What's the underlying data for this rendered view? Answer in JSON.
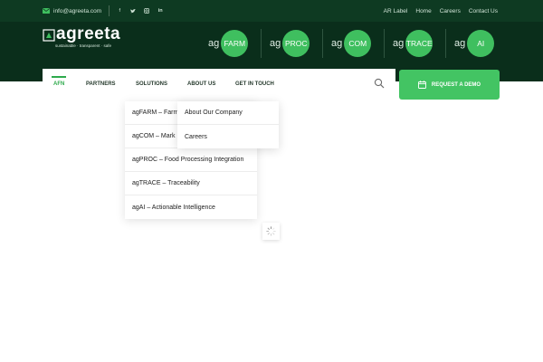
{
  "topbar": {
    "email": "info@agreeta.com",
    "social_icons": [
      "facebook-icon",
      "twitter-icon",
      "instagram-icon",
      "linkedin-icon"
    ],
    "links": [
      "AR Label",
      "Home",
      "Careers",
      "Contact Us"
    ]
  },
  "logo": {
    "word": "agreeta",
    "tagline": "sustainable · transparent · safe"
  },
  "products": [
    {
      "prefix": "ag",
      "name": "FARM"
    },
    {
      "prefix": "ag",
      "name": "PROC"
    },
    {
      "prefix": "ag",
      "name": "COM"
    },
    {
      "prefix": "ag",
      "name": "TRACE"
    },
    {
      "prefix": "ag",
      "name": "AI"
    }
  ],
  "nav": {
    "items": [
      "AFN",
      "PARTNERS",
      "SOLUTIONS",
      "ABOUT US",
      "GET IN TOUCH"
    ],
    "active": "AFN"
  },
  "demo_button": "REQUEST A DEMO",
  "solutions_menu": [
    "agFARM – Farm",
    "agCOM – Mark",
    "agPROC – Food Processing Integration",
    "agTRACE – Traceability",
    "agAI – Actionable Intelligence"
  ],
  "about_menu": [
    "About Our Company",
    "Careers"
  ],
  "colors": {
    "topbar_bg": "#0e3a22",
    "header_bg": "#0a2e1b",
    "accent_green": "#43c463"
  }
}
